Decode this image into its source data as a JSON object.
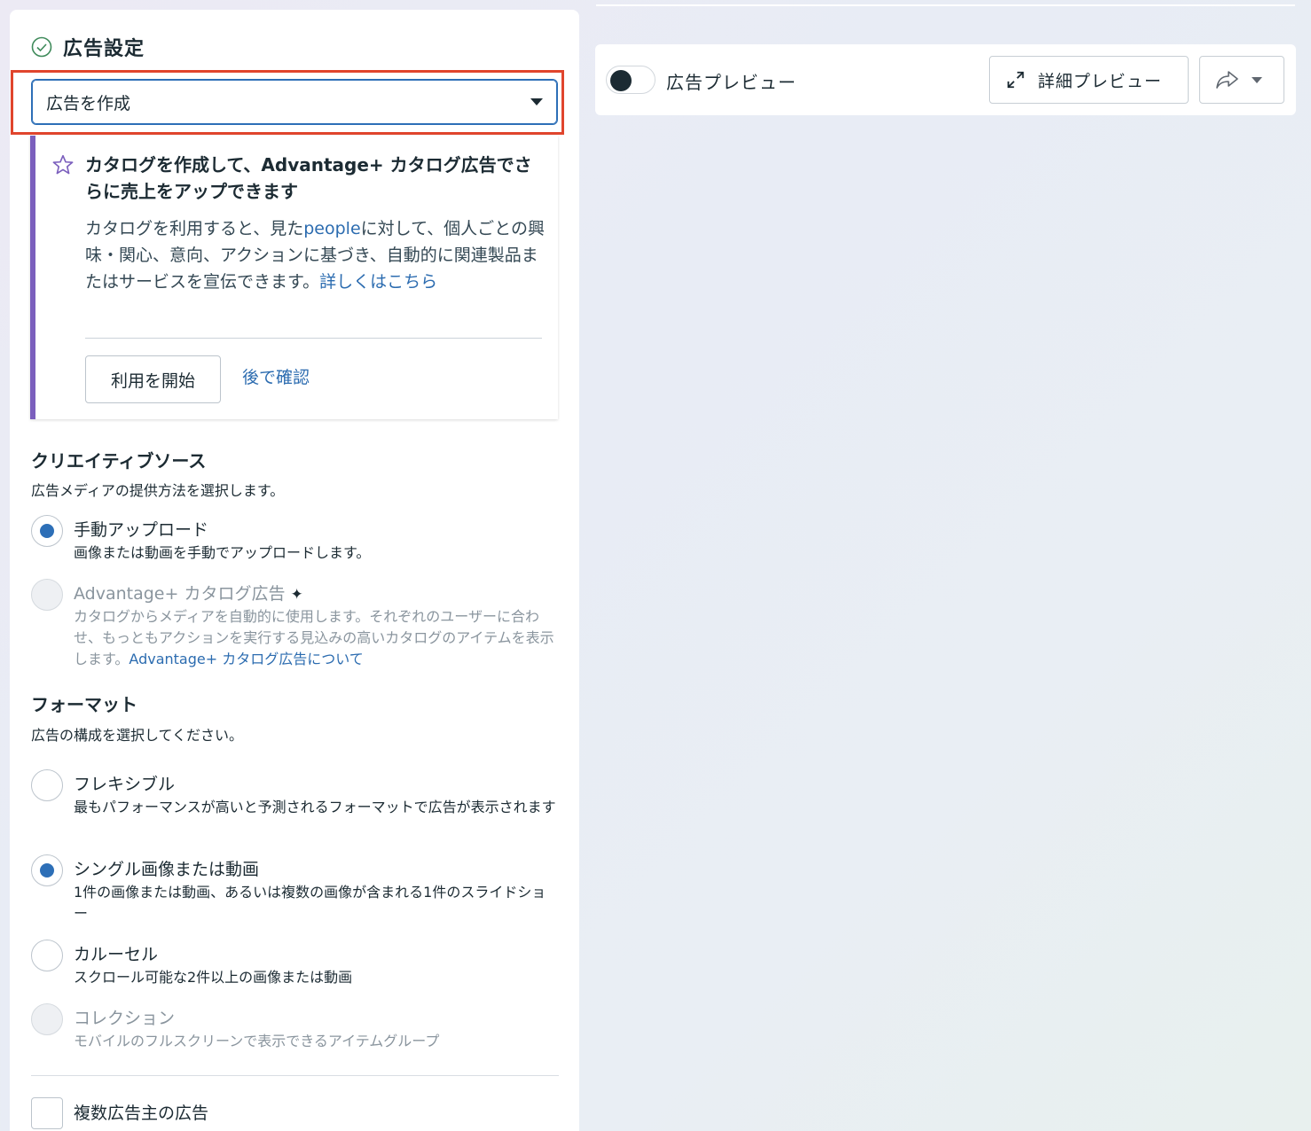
{
  "ad_settings": {
    "title": "広告設定",
    "select_value": "広告を作成"
  },
  "promo": {
    "title": "カタログを作成して、Advantage+ カタログ広告でさらに売上をアップできます",
    "body_1": "カタログを利用すると、見た",
    "body_link_people": "people",
    "body_2": "に対して、個人ごとの興味・関心、意向、アクションに基づき、自動的に関連製品またはサービスを宣伝できます。",
    "body_link_more": "詳しくはこちら",
    "start_button": "利用を開始",
    "later_link": "後で確認"
  },
  "creative_source": {
    "title": "クリエイティブソース",
    "subtitle": "広告メディアの提供方法を選択します。",
    "options": [
      {
        "label": "手動アップロード",
        "desc": "画像または動画を手動でアップロードします。"
      },
      {
        "label": "Advantage+ カタログ広告",
        "desc": "カタログからメディアを自動的に使用します。それぞれのユーザーに合わせ、もっともアクションを実行する見込みの高いカタログのアイテムを表示します。",
        "link": "Advantage+ カタログ広告について"
      }
    ]
  },
  "format": {
    "title": "フォーマット",
    "subtitle": "広告の構成を選択してください。",
    "options": [
      {
        "label": "フレキシブル",
        "desc": "最もパフォーマンスが高いと予測されるフォーマットで広告が表示されます"
      },
      {
        "label": "シングル画像または動画",
        "desc": "1件の画像または動画、あるいは複数の画像が含まれる1件のスライドショー"
      },
      {
        "label": "カルーセル",
        "desc": "スクロール可能な2件以上の画像または動画"
      },
      {
        "label": "コレクション",
        "desc": "モバイルのフルスクリーンで表示できるアイテムグループ"
      }
    ]
  },
  "multi_advertiser": {
    "label": "複数広告主の広告"
  },
  "preview": {
    "label": "広告プレビュー",
    "detail_button": "詳細プレビュー"
  },
  "colors": {
    "accent_blue": "#2d6fb7",
    "highlight_red": "#e0452d",
    "promo_purple": "#7b5fbd"
  }
}
